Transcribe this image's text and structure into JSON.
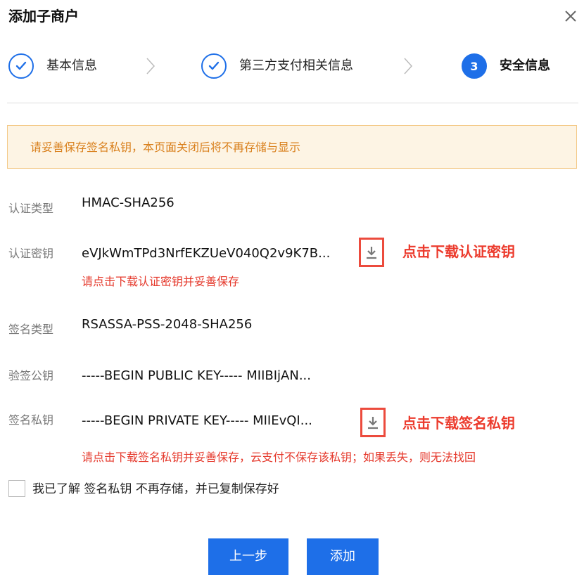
{
  "dialog": {
    "title": "添加子商户",
    "steps": [
      {
        "label": "基本信息",
        "state": "done"
      },
      {
        "label": "第三方支付相关信息",
        "state": "done"
      },
      {
        "label": "安全信息",
        "number": "3",
        "state": "active"
      }
    ]
  },
  "alert": {
    "text": "请妥善保存签名私钥，本页面关闭后将不再存储与显示"
  },
  "fields": {
    "auth_type": {
      "label": "认证类型",
      "value": "HMAC-SHA256"
    },
    "auth_key": {
      "label": "认证密钥",
      "value": "eVJkWmTPd3NrfEKZUeV040Q2v9K7B...",
      "hint": "请点击下载认证密钥并妥善保存",
      "annotation": "点击下载认证密钥"
    },
    "sign_type": {
      "label": "签名类型",
      "value": "RSASSA-PSS-2048-SHA256"
    },
    "verify_pubkey": {
      "label": "验签公钥",
      "value": "-----BEGIN PUBLIC KEY----- MIIBIjAN..."
    },
    "sign_privkey": {
      "label": "签名私钥",
      "value": "-----BEGIN PRIVATE KEY----- MIIEvQI...",
      "hint": "请点击下载签名私钥并妥善保存，云支付不保存该私钥；如果丢失，则无法找回",
      "annotation": "点击下载签名私钥"
    }
  },
  "confirm": {
    "label": "我已了解 签名私钥 不再存储，并已复制保存好",
    "checked": false
  },
  "buttons": {
    "prev": "上一步",
    "add": "添加"
  },
  "colors": {
    "primary": "#1e6fe8",
    "warning_bg": "#fdf4e4",
    "warning_text": "#d9801d",
    "error": "#e5382b",
    "annotation": "#ec3b2d"
  },
  "icons": [
    "close-icon",
    "check-icon",
    "chevron-right-icon",
    "download-icon"
  ]
}
